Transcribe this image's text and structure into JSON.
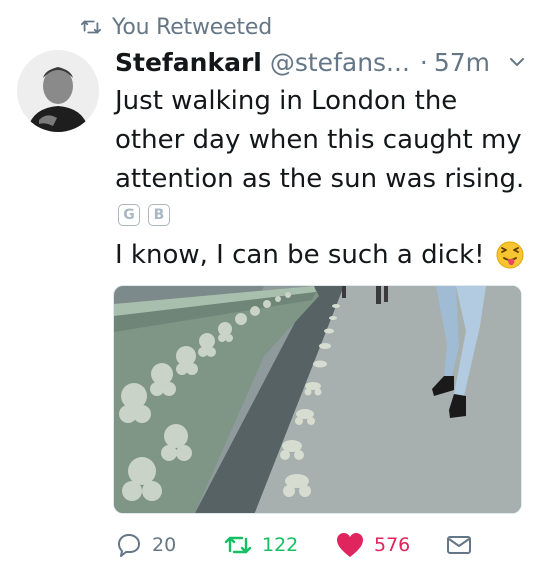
{
  "context": {
    "label": "You Retweeted",
    "icon": "retweet-icon"
  },
  "tweet": {
    "author_name": "Stefankarl",
    "author_handle": "@stefans...",
    "separator": "·",
    "timestamp": "57m",
    "text_lines": [
      "Just walking in London the",
      "other day when this caught my",
      "attention as the sun was rising."
    ],
    "translate_chips": [
      "G",
      "B"
    ],
    "second_line": "I know, I can be such a dick!",
    "emoji": "face-with-stuck-out-tongue-and-winking-eye"
  },
  "actions": {
    "reply_count": "20",
    "retweet_count": "122",
    "like_count": "576"
  },
  "colors": {
    "muted": "#657786",
    "retweet_green": "#17bf63",
    "like_red": "#e0245e",
    "text": "#14171a"
  }
}
